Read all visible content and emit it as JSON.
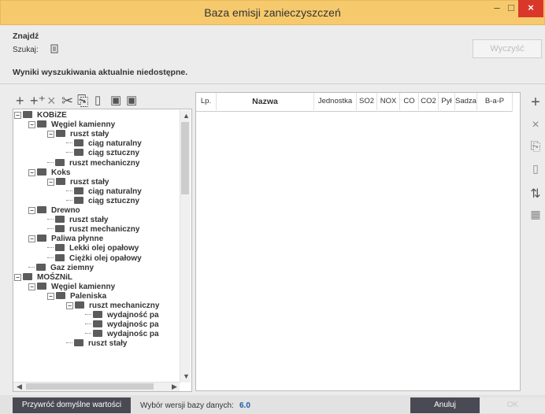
{
  "window": {
    "title": "Baza emisji zanieczyszczeń",
    "min": "–",
    "max": "□",
    "close": "×"
  },
  "find": {
    "heading": "Znajdź",
    "search_label": "Szukaj:",
    "clear_label": "Wyczyść",
    "results_text": "Wyniki wyszukiwania aktualnie niedostępne."
  },
  "toolbar_icons": [
    "add-icon",
    "add-child-icon",
    "delete-icon",
    "cut-icon",
    "paste-icon",
    "copy-icon",
    "export-icon",
    "import-icon"
  ],
  "tree": [
    {
      "label": "KOBiZE",
      "level": 0
    },
    {
      "label": "Węgiel kamienny",
      "level": 1
    },
    {
      "label": "ruszt stały",
      "level": 2
    },
    {
      "label": "ciąg naturalny",
      "level": 3
    },
    {
      "label": "ciąg sztuczny",
      "level": 3
    },
    {
      "label": "ruszt mechaniczny",
      "level": 2
    },
    {
      "label": "Koks",
      "level": 1
    },
    {
      "label": "ruszt stały",
      "level": 2
    },
    {
      "label": "ciąg naturalny",
      "level": 3
    },
    {
      "label": "ciąg sztuczny",
      "level": 3
    },
    {
      "label": "Drewno",
      "level": 1
    },
    {
      "label": "ruszt stały",
      "level": 2
    },
    {
      "label": "ruszt mechaniczny",
      "level": 2
    },
    {
      "label": "Paliwa płynne",
      "level": 1
    },
    {
      "label": "Lekki olej opałowy",
      "level": 2
    },
    {
      "label": "Ciężki olej opałowy",
      "level": 2
    },
    {
      "label": "Gaz ziemny",
      "level": 1
    },
    {
      "label": "MOŚZNiL",
      "level": 0
    },
    {
      "label": "Węgiel kamienny",
      "level": 1
    },
    {
      "label": "Paleniska",
      "level": 2
    },
    {
      "label": "ruszt mechaniczny",
      "level": 3
    },
    {
      "label": "wydajność pa",
      "level": 4
    },
    {
      "label": "wydajnośc pa",
      "level": 4
    },
    {
      "label": "wydajnośc pa",
      "level": 4
    },
    {
      "label": "ruszt stały",
      "level": 3
    }
  ],
  "grid": {
    "columns": [
      "Lp.",
      "Nazwa",
      "Jednostka",
      "SO2",
      "NOX",
      "CO",
      "CO2",
      "Pył",
      "Sadza",
      "B-a-P"
    ]
  },
  "side_icons": [
    "add-icon",
    "delete-icon",
    "paste-icon",
    "copy-icon",
    "refresh-icon",
    "calculator-icon"
  ],
  "footer": {
    "restore_label": "Przywróć domyślne wartości",
    "version_label": "Wybór wersji bazy danych:",
    "version_value": "6.0",
    "cancel_label": "Anuluj",
    "ok_label": "OK"
  }
}
